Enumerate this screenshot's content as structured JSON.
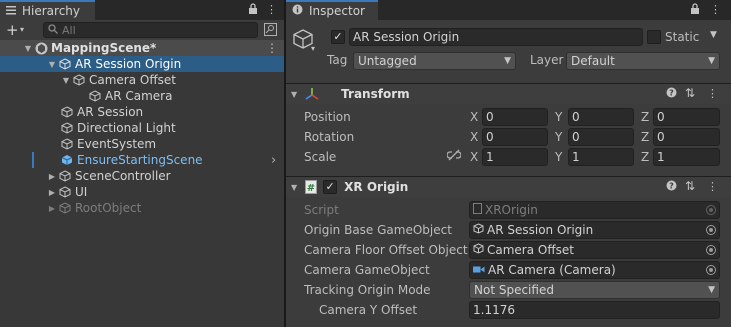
{
  "hierarchy": {
    "tab_label": "Hierarchy",
    "search_placeholder": "All",
    "scene": "MappingScene*",
    "items": [
      {
        "label": "AR Session Origin"
      },
      {
        "label": "Camera Offset"
      },
      {
        "label": "AR Camera"
      },
      {
        "label": "AR Session"
      },
      {
        "label": "Directional Light"
      },
      {
        "label": "EventSystem"
      },
      {
        "label": "EnsureStartingScene"
      },
      {
        "label": "SceneController"
      },
      {
        "label": "UI"
      },
      {
        "label": "RootObject"
      }
    ]
  },
  "inspector": {
    "tab_label": "Inspector",
    "object_name": "AR Session Origin",
    "static_label": "Static",
    "tag_label": "Tag",
    "tag_value": "Untagged",
    "layer_label": "Layer",
    "layer_value": "Default",
    "transform": {
      "title": "Transform",
      "position_label": "Position",
      "rotation_label": "Rotation",
      "scale_label": "Scale",
      "x": "X",
      "y": "Y",
      "z": "Z",
      "position": [
        "0",
        "0",
        "0"
      ],
      "rotation": [
        "0",
        "0",
        "0"
      ],
      "scale": [
        "1",
        "1",
        "1"
      ]
    },
    "xr_origin": {
      "title": "XR Origin",
      "fields": [
        {
          "label": "Script",
          "value": "XROrigin"
        },
        {
          "label": "Origin Base GameObject",
          "value": "AR Session Origin"
        },
        {
          "label": "Camera Floor Offset Object",
          "value": "Camera Offset"
        },
        {
          "label": "Camera GameObject",
          "value": "AR Camera (Camera)"
        }
      ],
      "tracking_label": "Tracking Origin Mode",
      "tracking_value": "Not Specified",
      "offset_label": "Camera Y Offset",
      "offset_value": "1.1176"
    }
  },
  "colors": {
    "selection": "#2c5d87",
    "prefab_text": "#7cbef5",
    "tab_accent": "#3a79bb"
  }
}
